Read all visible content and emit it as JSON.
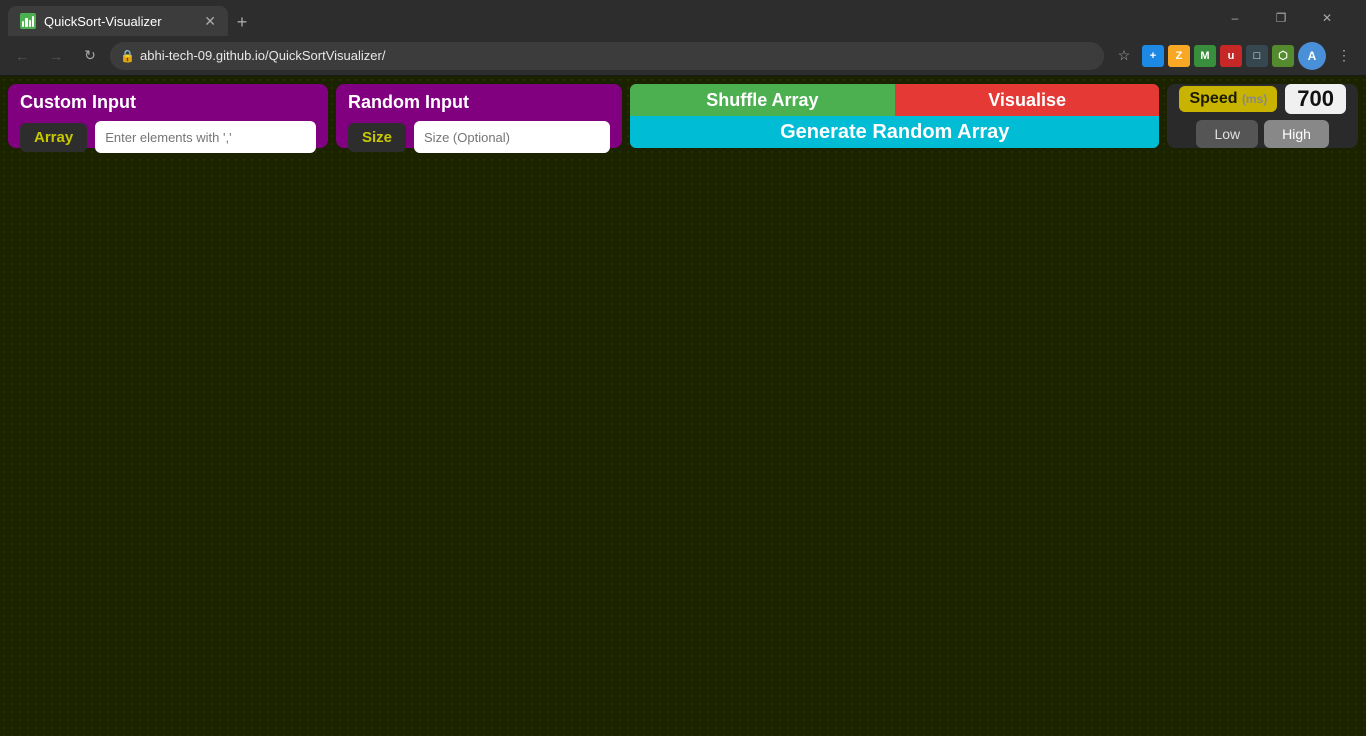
{
  "browser": {
    "tab_title": "QuickSort-Visualizer",
    "tab_favicon": "bar-chart-icon",
    "url": "abhi-tech-09.github.io/QuickSortVisualizer/",
    "window_minimize": "–",
    "window_restore": "❐",
    "window_close": "✕",
    "new_tab": "+"
  },
  "toolbar": {
    "nav_back": "←",
    "nav_forward": "→",
    "nav_refresh": "↻",
    "menu_dots": "⋮"
  },
  "app": {
    "custom_input": {
      "section_title": "Custom Input",
      "array_label": "Array",
      "array_placeholder": "Enter elements with ','",
      "array_value": ""
    },
    "random_input": {
      "section_title": "Random Input",
      "size_label": "Size",
      "size_placeholder": "Size (Optional)",
      "size_value": ""
    },
    "actions": {
      "shuffle_label": "Shuffle Array",
      "visualise_label": "Visualise",
      "generate_label": "Generate Random Array"
    },
    "speed": {
      "label": "Speed",
      "unit": "(ms)",
      "value": "700",
      "low_label": "Low",
      "high_label": "High"
    }
  }
}
